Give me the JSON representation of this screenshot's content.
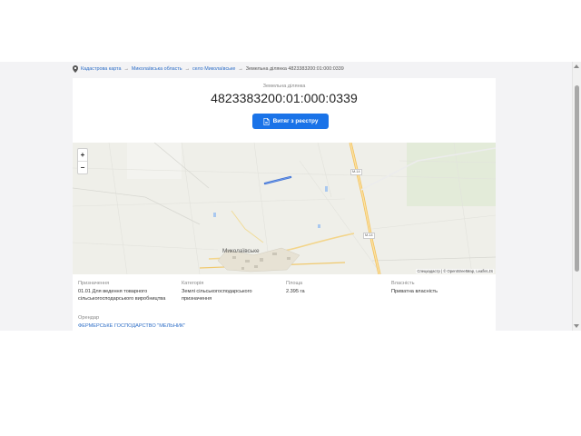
{
  "breadcrumb": {
    "items": [
      "Кадастрова карта",
      "Миколаївська область",
      "село Миколаївське"
    ],
    "current": "Земельна ділянка 4823383200:01:000:0339",
    "separator": "→"
  },
  "parcel": {
    "subtitle": "Земельна ділянка",
    "cadastral_number": "4823383200:01:000:0339",
    "extract_button": "Витяг з реєстру"
  },
  "map": {
    "zoom_in": "+",
    "zoom_out": "−",
    "town_label": "Миколаївське",
    "road_label_1": "М-14",
    "road_label_2": "М-14",
    "attribution": "Спецкадастр | © OpenStreetMap, Leaflet.JS"
  },
  "details": {
    "purpose_label": "Призначення",
    "purpose_line1": "01.01 Для ведення товарного",
    "purpose_line2": "сільськогосподарського виробництва",
    "category_label": "Категорія",
    "category_line1": "Землі сільськогосподарського",
    "category_line2": "призначення",
    "area_label": "Площа",
    "area_value": "2.395 га",
    "ownership_label": "Власність",
    "ownership_value": "Приватна власність",
    "tenant_label": "Орендар",
    "tenant_value": "ФЕРМЕРСЬКЕ ГОСПОДАРСТВО \"МЕЛЬНИК\""
  },
  "colors": {
    "accent": "#1a73e8",
    "link": "#2f6fc7",
    "parcel_outline": "#3c6fd4"
  },
  "icons": [
    "map-pin-icon",
    "document-icon"
  ]
}
